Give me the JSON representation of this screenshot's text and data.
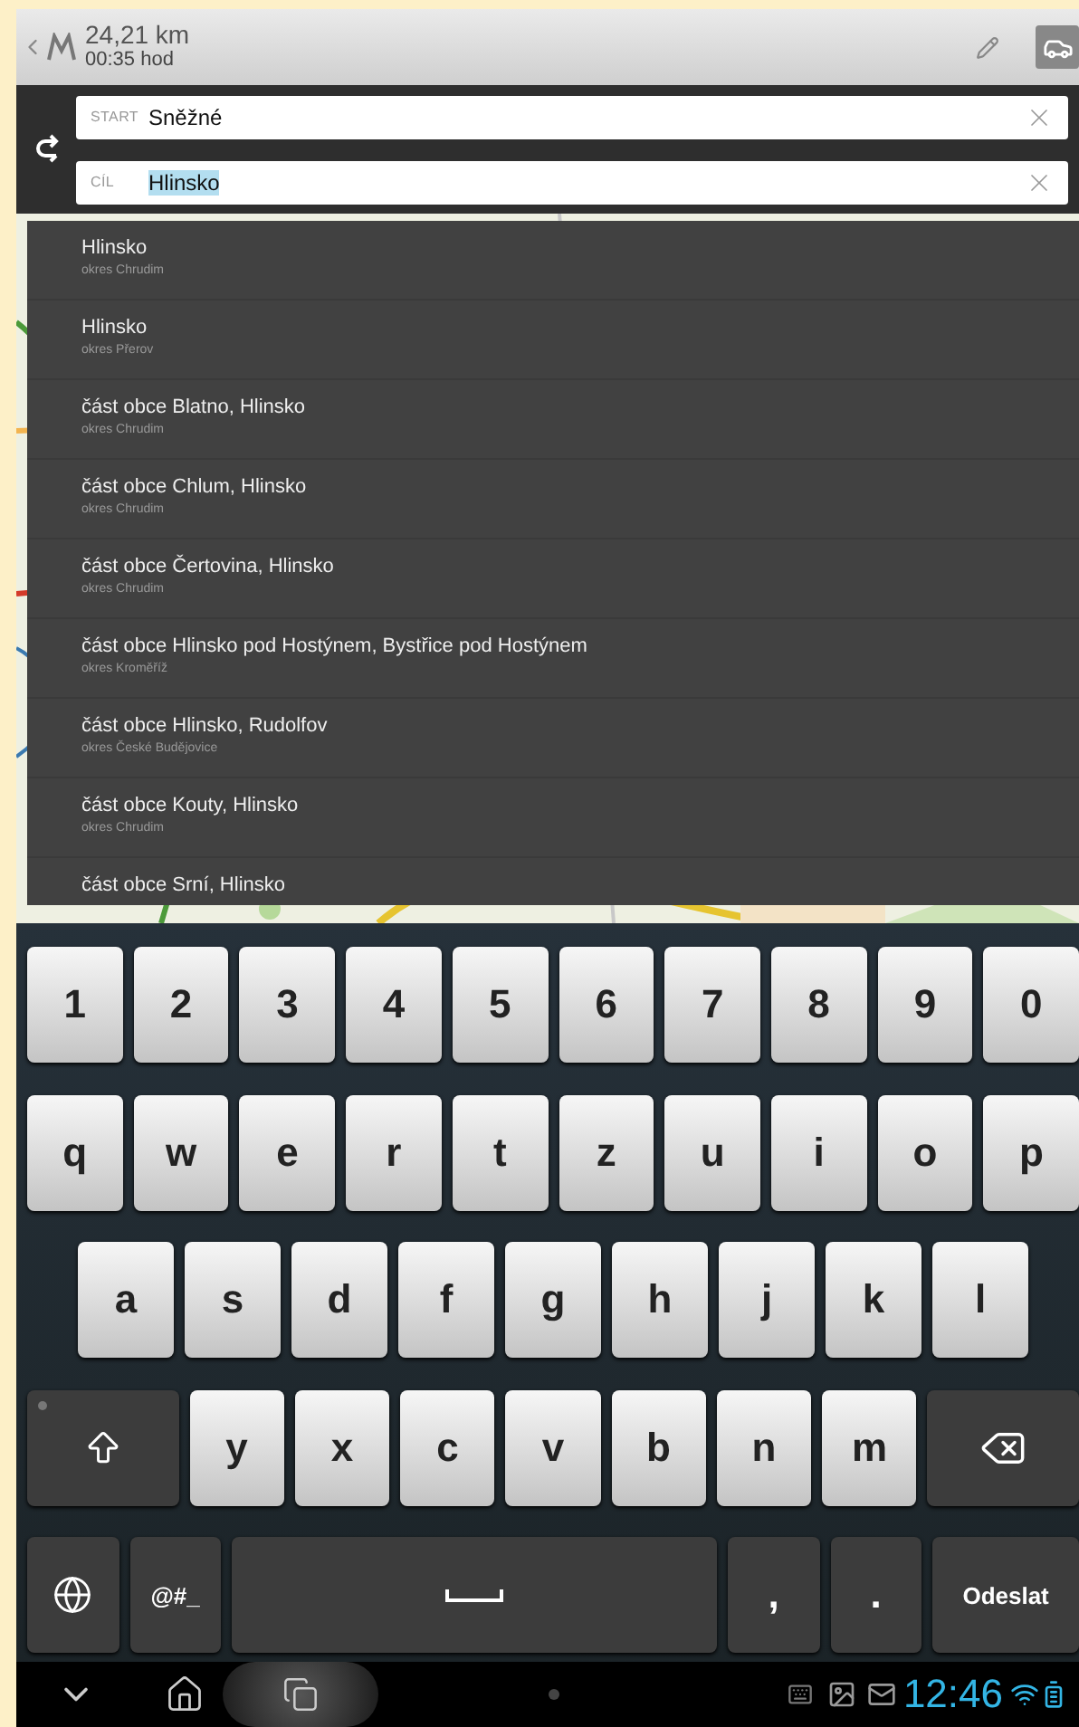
{
  "route": {
    "distance": "24,21 km",
    "duration": "00:35 hod"
  },
  "fields": [
    {
      "label": "START",
      "value": "Sněžné",
      "highlighted": false
    },
    {
      "label": "CÍL",
      "value": "Hlinsko",
      "highlighted": true
    }
  ],
  "suggestions": [
    {
      "name": "Hlinsko",
      "district": "okres Chrudim"
    },
    {
      "name": "Hlinsko",
      "district": "okres Přerov"
    },
    {
      "name": "část obce Blatno, Hlinsko",
      "district": "okres Chrudim"
    },
    {
      "name": "část obce Chlum, Hlinsko",
      "district": "okres Chrudim"
    },
    {
      "name": "část obce Čertovina, Hlinsko",
      "district": "okres Chrudim"
    },
    {
      "name": "část obce Hlinsko pod Hostýnem, Bystřice pod Hostýnem",
      "district": "okres Kroměříž"
    },
    {
      "name": "část obce Hlinsko, Rudolfov",
      "district": "okres České Budějovice"
    },
    {
      "name": "část obce Kouty, Hlinsko",
      "district": "okres Chrudim"
    },
    {
      "name": "část obce Srní, Hlinsko"
    }
  ],
  "keyboard": {
    "rows": [
      {
        "keys": [
          {
            "kind": "char",
            "label": "1"
          },
          {
            "kind": "char",
            "label": "2"
          },
          {
            "kind": "char",
            "label": "3"
          },
          {
            "kind": "char",
            "label": "4"
          },
          {
            "kind": "char",
            "label": "5"
          },
          {
            "kind": "char",
            "label": "6"
          },
          {
            "kind": "char",
            "label": "7"
          },
          {
            "kind": "char",
            "label": "8"
          },
          {
            "kind": "char",
            "label": "9"
          },
          {
            "kind": "char",
            "label": "0"
          }
        ]
      },
      {
        "keys": [
          {
            "kind": "char",
            "label": "q"
          },
          {
            "kind": "char",
            "label": "w"
          },
          {
            "kind": "char",
            "label": "e"
          },
          {
            "kind": "char",
            "label": "r"
          },
          {
            "kind": "char",
            "label": "t"
          },
          {
            "kind": "char",
            "label": "z"
          },
          {
            "kind": "char",
            "label": "u"
          },
          {
            "kind": "char",
            "label": "i"
          },
          {
            "kind": "char",
            "label": "o"
          },
          {
            "kind": "char",
            "label": "p"
          }
        ]
      },
      {
        "keys": [
          {
            "kind": "char",
            "label": "a"
          },
          {
            "kind": "char",
            "label": "s"
          },
          {
            "kind": "char",
            "label": "d"
          },
          {
            "kind": "char",
            "label": "f"
          },
          {
            "kind": "char",
            "label": "g"
          },
          {
            "kind": "char",
            "label": "h"
          },
          {
            "kind": "char",
            "label": "j"
          },
          {
            "kind": "char",
            "label": "k"
          },
          {
            "kind": "char",
            "label": "l"
          }
        ]
      },
      {
        "keys": [
          {
            "kind": "shift"
          },
          {
            "kind": "char",
            "label": "y"
          },
          {
            "kind": "char",
            "label": "x"
          },
          {
            "kind": "char",
            "label": "c"
          },
          {
            "kind": "char",
            "label": "v"
          },
          {
            "kind": "char",
            "label": "b"
          },
          {
            "kind": "char",
            "label": "n"
          },
          {
            "kind": "char",
            "label": "m"
          },
          {
            "kind": "backspace"
          }
        ]
      },
      {
        "keys": [
          {
            "kind": "globe"
          },
          {
            "kind": "symbols",
            "label": "@#_"
          },
          {
            "kind": "space"
          },
          {
            "kind": "punct",
            "label": ","
          },
          {
            "kind": "punct",
            "label": "."
          },
          {
            "kind": "action",
            "label": "Odeslat"
          }
        ]
      }
    ]
  },
  "status_bar": {
    "time": "12:46"
  }
}
